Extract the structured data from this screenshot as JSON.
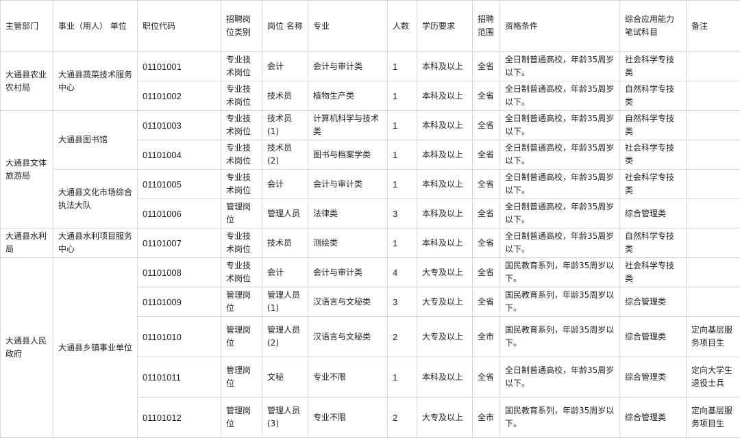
{
  "header": {
    "dept": "主管部门",
    "unit": "事业（用人） 单位",
    "code": "职位代码",
    "post_type": "招聘岗位类别",
    "post_name": "岗位 名称",
    "major": "专业",
    "count": "人数",
    "education": "学历要求",
    "scope": "招聘范围",
    "qualification": "资格条件",
    "exam": "综合应用能力笔试科目",
    "remark": "备注"
  },
  "depts": [
    "大通县农业农村局",
    "大通县文体旅游局",
    "大通县水利局",
    "大通县人民政府"
  ],
  "units": [
    "大通县蔬菜技术服务中心",
    "大通县图书馆",
    "大通县文化市场综合执法大队",
    "大通县水利项目服务中心",
    "大通县乡镇事业单位"
  ],
  "rows": [
    {
      "code": "01101001",
      "post_type": "专业技术岗位",
      "post_name": "会计",
      "major": "会计与审计类",
      "count": "1",
      "education": "本科及以上",
      "scope": "全省",
      "qualification": "全日制普通高校，年龄35周岁以下。",
      "exam": "社会科学专技类",
      "remark": ""
    },
    {
      "code": "01101002",
      "post_type": "专业技术岗位",
      "post_name": "技术员",
      "major": "植物生产类",
      "count": "1",
      "education": "本科及以上",
      "scope": "全省",
      "qualification": "全日制普通高校，年龄35周岁以下。",
      "exam": "自然科学专技类",
      "remark": ""
    },
    {
      "code": "01101003",
      "post_type": "专业技术岗位",
      "post_name": "技术员(1)",
      "major": "计算机科学与技术类",
      "count": "1",
      "education": "本科及以上",
      "scope": "全省",
      "qualification": "全日制普通高校，年龄35周岁以下。",
      "exam": "自然科学专技类",
      "remark": ""
    },
    {
      "code": "01101004",
      "post_type": "专业技术岗位",
      "post_name": "技术员(2)",
      "major": "图书与档案学类",
      "count": "1",
      "education": "本科及以上",
      "scope": "全省",
      "qualification": "全日制普通高校，年龄35周岁以下。",
      "exam": "社会科学专技类",
      "remark": ""
    },
    {
      "code": "01101005",
      "post_type": "专业技术岗位",
      "post_name": "会计",
      "major": "会计与审计类",
      "count": "1",
      "education": "本科及以上",
      "scope": "全省",
      "qualification": "全日制普通高校，年龄35周岁以下。",
      "exam": "社会科学专技类",
      "remark": ""
    },
    {
      "code": "01101006",
      "post_type": "管理岗位",
      "post_name": "管理人员",
      "major": "法律类",
      "count": "3",
      "education": "本科及以上",
      "scope": "全省",
      "qualification": "全日制普通高校，年龄35周岁以下。",
      "exam": "综合管理类",
      "remark": ""
    },
    {
      "code": "01101007",
      "post_type": "专业技术岗位",
      "post_name": "技术员",
      "major": "测绘类",
      "count": "1",
      "education": "本科及以上",
      "scope": "全省",
      "qualification": "全日制普通高校，年龄35周岁以下。",
      "exam": "自然科学专技类",
      "remark": ""
    },
    {
      "code": "01101008",
      "post_type": "专业技术岗位",
      "post_name": "会计",
      "major": "会计与审计类",
      "count": "4",
      "education": "大专及以上",
      "scope": "全省",
      "qualification": "国民教育系列，年龄35周岁以下。",
      "exam": "社会科学专技类",
      "remark": ""
    },
    {
      "code": "01101009",
      "post_type": "管理岗位",
      "post_name": "管理人员(1)",
      "major": "汉语言与文秘类",
      "count": "3",
      "education": "大专及以上",
      "scope": "全省",
      "qualification": "国民教育系列，年龄35周岁以下。",
      "exam": "综合管理类",
      "remark": ""
    },
    {
      "code": "01101010",
      "post_type": "管理岗位",
      "post_name": "管理人员(2)",
      "major": "汉语言与文秘类",
      "count": "2",
      "education": "大专及以上",
      "scope": "全市",
      "qualification": "国民教育系列，年龄35周岁以下。",
      "exam": "综合管理类",
      "remark": "定向基层服务项目生"
    },
    {
      "code": "01101011",
      "post_type": "管理岗位",
      "post_name": "文秘",
      "major": "专业不限",
      "count": "1",
      "education": "本科及以上",
      "scope": "全省",
      "qualification": "全日制普通高校，年龄35周岁以下。",
      "exam": "综合管理类",
      "remark": "定向大学生退役士兵"
    },
    {
      "code": "01101012",
      "post_type": "管理岗位",
      "post_name": "管理人员(3)",
      "major": "专业不限",
      "count": "2",
      "education": "大专及以上",
      "scope": "全市",
      "qualification": "国民教育系列，年龄35周岁以下。",
      "exam": "综合管理类",
      "remark": "定向基层服务项目生"
    }
  ]
}
